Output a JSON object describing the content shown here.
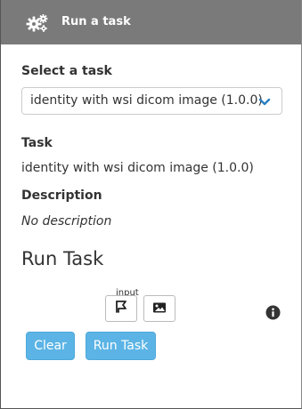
{
  "header": {
    "title": "Run a task",
    "icon": "gears-icon"
  },
  "select_task": {
    "label": "Select a task",
    "selected_value": "identity with wsi dicom image (1.0.0)",
    "icon": "chevron-down-icon"
  },
  "task": {
    "label": "Task",
    "value": "identity with wsi dicom image (1.0.0)"
  },
  "description": {
    "label": "Description",
    "value": "No description"
  },
  "run_task": {
    "heading": "Run Task",
    "input_caption": "input",
    "input_icons": [
      "region-flag-icon",
      "image-icon"
    ],
    "info_icon": "info-icon"
  },
  "actions": {
    "clear_label": "Clear",
    "run_label": "Run Task"
  },
  "colors": {
    "header_bg": "#7a7a7a",
    "button_bg": "#5bb4e5",
    "accent_chevron": "#2a7fc0"
  }
}
